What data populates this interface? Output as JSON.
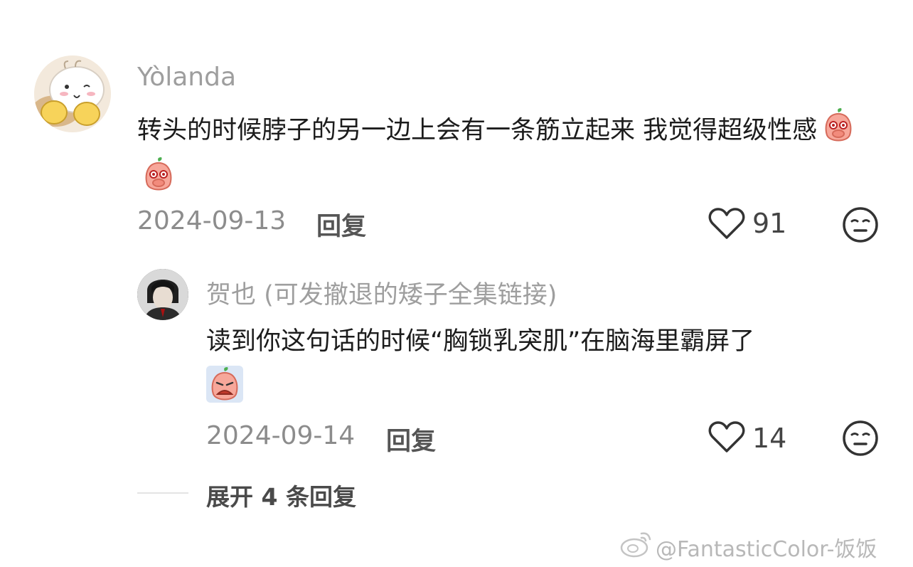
{
  "comments": [
    {
      "username": "Yòlanda",
      "text": "转头的时候脖子的另一边上会有一条筋立起来 我觉得超级性感",
      "date": "2024-09-13",
      "reply_label": "回复",
      "likes": "91",
      "replies": [
        {
          "username": "贺也 (可发撤退的矮子全集链接)",
          "text": "读到你这句话的时候“胸锁乳突肌”在脑海里霸屏了",
          "date": "2024-09-14",
          "reply_label": "回复",
          "likes": "14"
        }
      ]
    }
  ],
  "expand_label": "展开 4 条回复",
  "watermark": "@FantasticColor-饭饭"
}
